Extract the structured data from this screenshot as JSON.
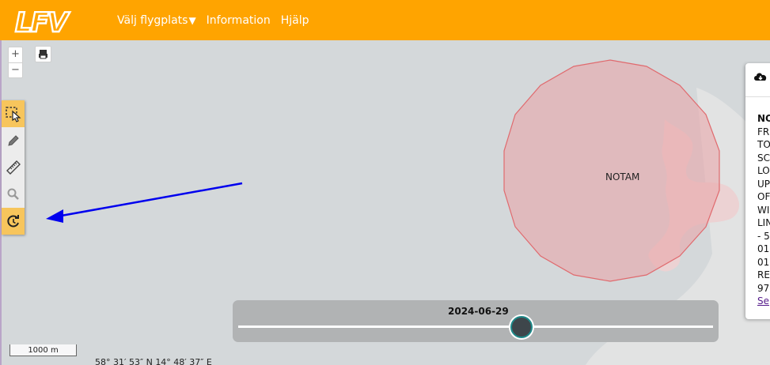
{
  "header": {
    "logo": "LFV",
    "nav": [
      {
        "label": "Välj flygplats",
        "caret": "▼"
      },
      {
        "label": "Information"
      },
      {
        "label": "Hjälp"
      }
    ]
  },
  "map": {
    "zoom_in": "+",
    "zoom_out": "−",
    "notam_label": "NOTAM",
    "scale_label": "1000 m",
    "coords": "58° 31′ 53″ N 14° 48′ 37″ E"
  },
  "tools": [
    {
      "icon": "select-area-icon",
      "active": true
    },
    {
      "icon": "pencil-icon",
      "active": false
    },
    {
      "icon": "ruler-icon",
      "active": false
    },
    {
      "icon": "search-icon",
      "active": false
    },
    {
      "icon": "history-icon",
      "active": true
    }
  ],
  "panel": {
    "lines": [
      "NO",
      "FR",
      "TO",
      "SC",
      "LO",
      "UP",
      "OF",
      "WI",
      "LIN",
      "- 5",
      "01",
      "01",
      "RE",
      "97"
    ],
    "link": "Se"
  },
  "timeline": {
    "date": "2024-06-29",
    "position": 0.6
  },
  "colors": {
    "header": "#ffa400",
    "notam_fill": "#e9a2a5",
    "notam_stroke": "#e06a6e",
    "arrow": "#0000ee"
  }
}
